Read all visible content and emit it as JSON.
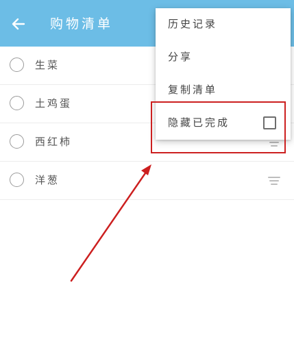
{
  "appbar": {
    "title": "购物清单",
    "back_icon": "arrow-left-icon",
    "background": "#6cbde6"
  },
  "items": [
    {
      "label": "生菜",
      "checked": false
    },
    {
      "label": "土鸡蛋",
      "checked": false
    },
    {
      "label": "西红柿",
      "checked": false
    },
    {
      "label": "洋葱",
      "checked": false
    }
  ],
  "menu": {
    "items": [
      {
        "label": "历史记录"
      },
      {
        "label": "分享"
      },
      {
        "label": "复制清单"
      },
      {
        "label": "隐藏已完成",
        "checkbox": true,
        "checked": false
      }
    ]
  },
  "annotation": {
    "highlight_color": "#cc1f1f"
  }
}
